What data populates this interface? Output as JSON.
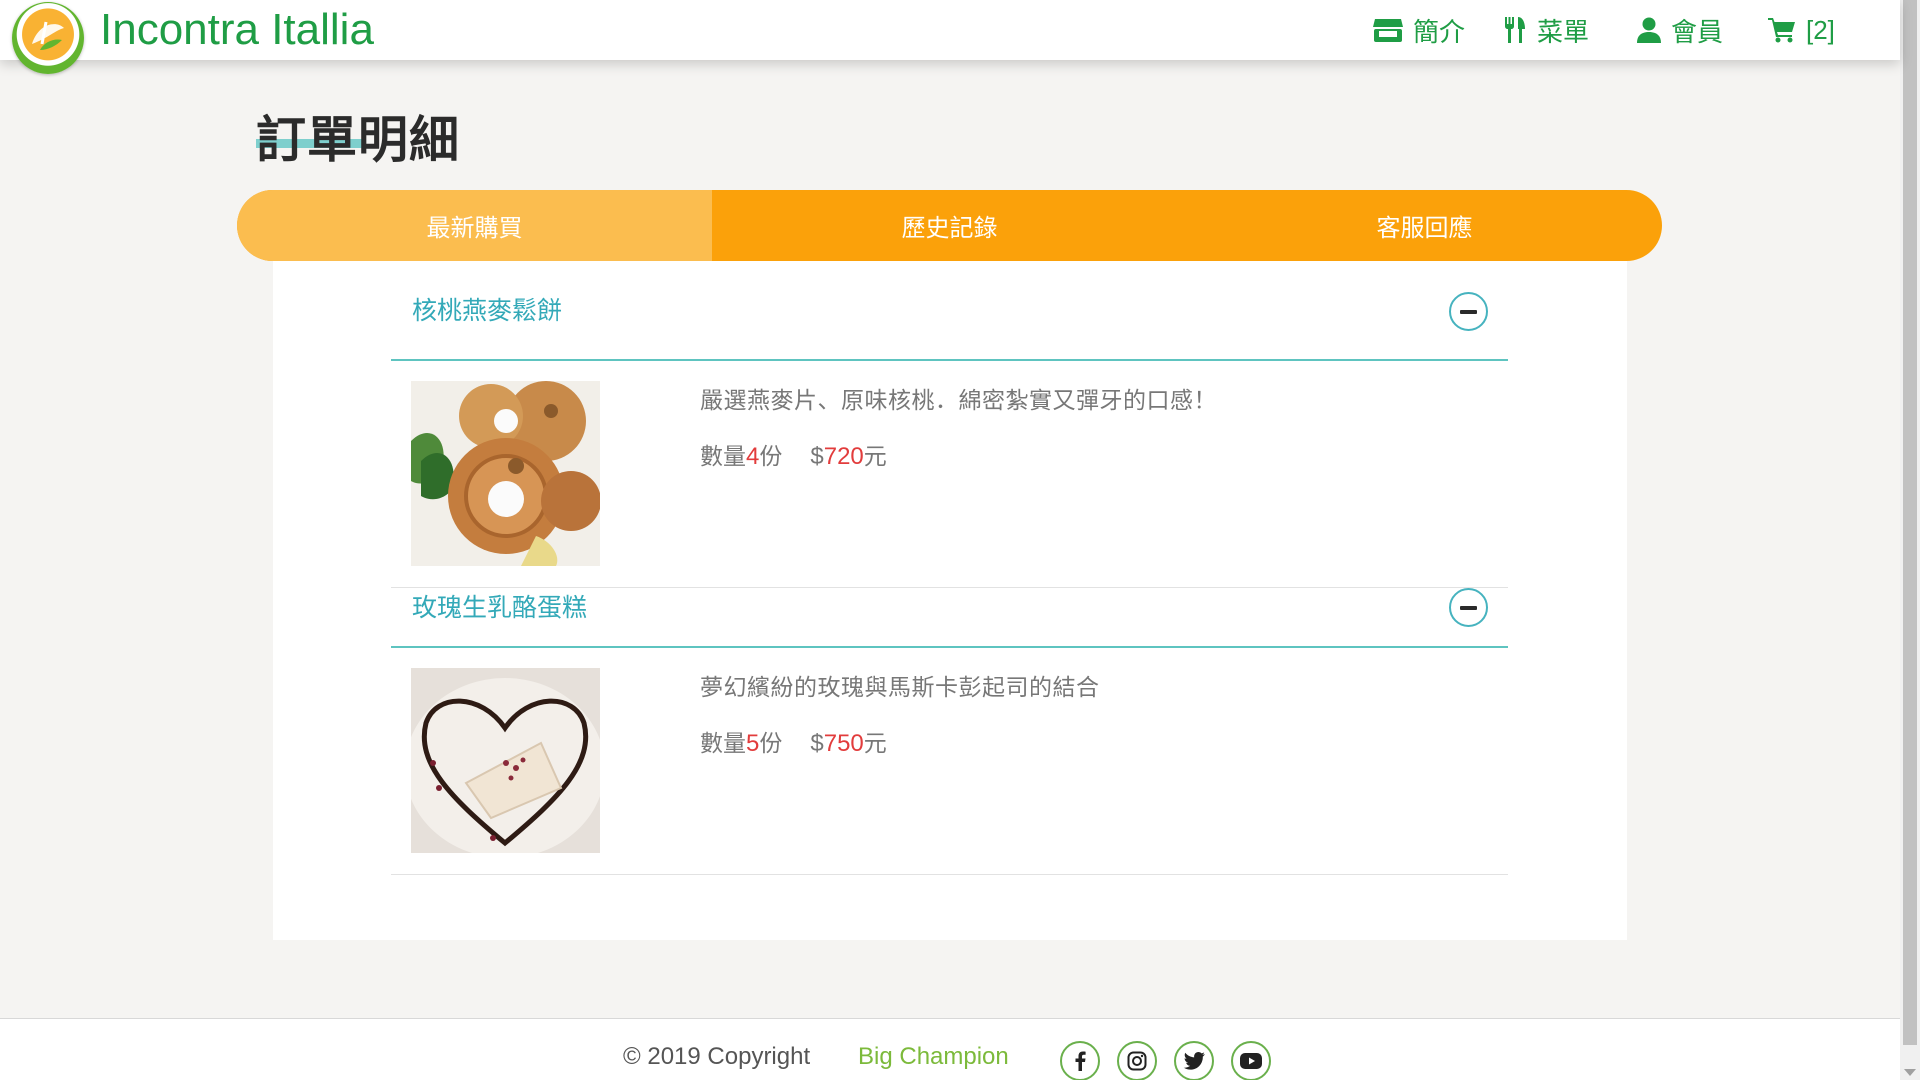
{
  "header": {
    "brand": "Incontra Itallia",
    "nav": [
      {
        "label": "簡介",
        "icon": "store-icon"
      },
      {
        "label": "菜單",
        "icon": "utensils-icon"
      },
      {
        "label": "會員",
        "icon": "user-icon"
      },
      {
        "label": "[2]",
        "icon": "cart-icon"
      }
    ]
  },
  "page": {
    "title": "訂單明細"
  },
  "tabs": [
    {
      "label": "最新購買",
      "active": true
    },
    {
      "label": "歷史記錄",
      "active": false
    },
    {
      "label": "客服回應",
      "active": false
    }
  ],
  "orders": [
    {
      "name": "核桃燕麥鬆餅",
      "description": "嚴選燕麥片、原味核桃．綿密紮實又彈牙的口感！",
      "qty_prefix": "數量",
      "qty": "4",
      "qty_unit": "份",
      "price_sign": "$",
      "price": "720",
      "price_unit": "元"
    },
    {
      "name": "玫瑰生乳酪蛋糕",
      "description": "夢幻繽紛的玫瑰與馬斯卡彭起司的結合",
      "qty_prefix": "數量",
      "qty": "5",
      "qty_unit": "份",
      "price_sign": "$",
      "price": "750",
      "price_unit": "元"
    }
  ],
  "footer": {
    "copyright": "© 2019 Copyright",
    "company": "Big Champion",
    "social": [
      "facebook-icon",
      "instagram-icon",
      "twitter-icon",
      "youtube-icon"
    ]
  },
  "colors": {
    "brand_green": "#1f9d45",
    "tab_orange": "#fba10a",
    "tab_active": "#fbbd4f",
    "teal": "#33a9b8",
    "price_red": "#e23c3c"
  }
}
